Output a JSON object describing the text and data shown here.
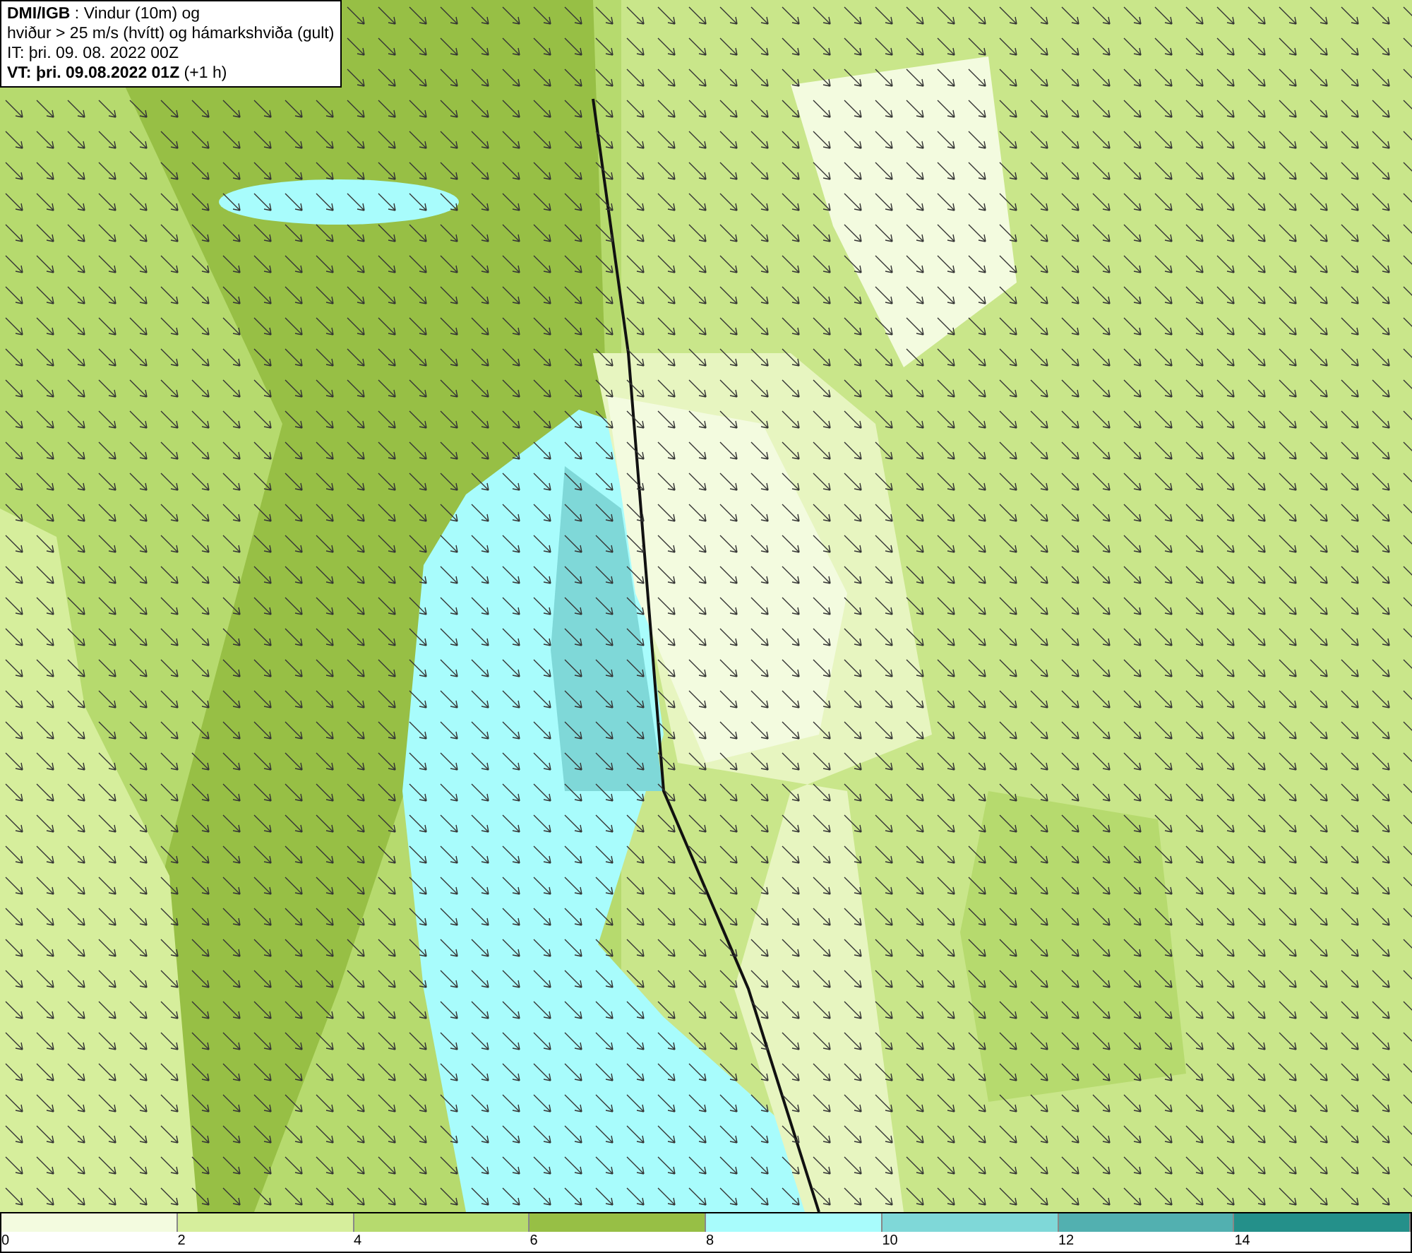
{
  "header": {
    "lines": [
      "**DMI/IGB** : Vindur (10m) og",
      "hviður > 25 m/s (hvítt) og hámarkshviða (gult)",
      "IT: þri. 09. 08. 2022 00Z",
      "**VT: þri. 09.08.2022 01Z** (+1 h)"
    ]
  },
  "legend": {
    "items": [
      {
        "label": "0",
        "color": "#f3fbdf"
      },
      {
        "label": "2",
        "color": "#d6ee9c"
      },
      {
        "label": "4",
        "color": "#b6da6e"
      },
      {
        "label": "6",
        "color": "#97bf45"
      },
      {
        "label": "8",
        "color": "#a8fcfc"
      },
      {
        "label": "10",
        "color": "#7fd8d8"
      },
      {
        "label": "12",
        "color": "#52b0b0"
      },
      {
        "label": "14",
        "color": "#24908a"
      }
    ]
  }
}
